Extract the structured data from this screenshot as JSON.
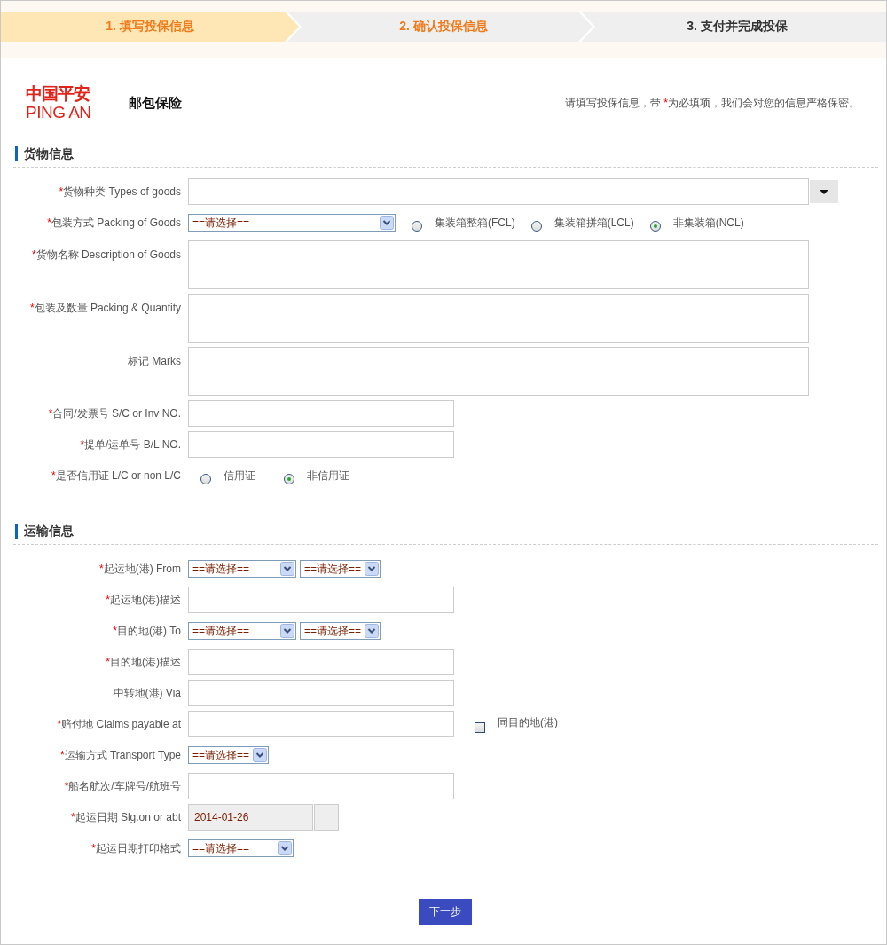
{
  "steps": [
    {
      "label": "1. 填写投保信息",
      "selected": true,
      "accent": true
    },
    {
      "label": "2. 确认投保信息",
      "selected": false,
      "accent": true
    },
    {
      "label": "3. 支付并完成投保",
      "selected": false,
      "accent": false
    }
  ],
  "header": {
    "logo_cn": "中国平安",
    "logo_en": "PING AN",
    "product": "邮包保险",
    "notice_before": "请填写投保信息，带 ",
    "notice_mark": "*",
    "notice_after": "为必填项，我们会对您的信息严格保密。"
  },
  "sections": [
    {
      "title": "货物信息",
      "rows": [
        {
          "kind": "combo",
          "mark": "*",
          "label": "货物种类  Types of goods"
        },
        {
          "kind": "select_radio",
          "mark": "*",
          "label": "包装方式  Packing of Goods",
          "value": "==请选择==",
          "options": [
            {
              "label": "集装箱整箱(FCL)",
              "selected": false
            },
            {
              "label": "集装箱拼箱(LCL)",
              "selected": false
            },
            {
              "label": "非集装箱(NCL)",
              "selected": true
            }
          ]
        },
        {
          "kind": "textarea",
          "mark": "*",
          "label": "货物名称  Description of Goods"
        },
        {
          "kind": "textarea",
          "mark": "*",
          "label": "包装及数量  Packing & Quantity"
        },
        {
          "kind": "textarea",
          "label": "标记  Marks"
        },
        {
          "kind": "text",
          "mark": "*",
          "label": "合同/发票号  S/C or Inv NO."
        },
        {
          "kind": "text",
          "mark": "*",
          "label": "提单/运单号  B/L NO."
        },
        {
          "kind": "radio",
          "mark": "*",
          "label": "是否信用证  L/C or non L/C",
          "options": [
            {
              "label": "信用证",
              "selected": false
            },
            {
              "label": "非信用证",
              "selected": true
            }
          ]
        }
      ]
    },
    {
      "title": "运输信息",
      "rows": [
        {
          "kind": "select_pair",
          "mark": "*",
          "label": "起运地(港) From",
          "values": [
            "==请选择==",
            "==请选择=="
          ]
        },
        {
          "kind": "text",
          "mark": "*",
          "label": "起运地(港)描述"
        },
        {
          "kind": "select_pair",
          "mark": "*",
          "label": "目的地(港) To",
          "values": [
            "==请选择==",
            "==请选择=="
          ]
        },
        {
          "kind": "text",
          "mark": "*",
          "label": "目的地(港)描述"
        },
        {
          "kind": "text",
          "label": "中转地(港) Via"
        },
        {
          "kind": "text_check",
          "mark": "*",
          "label": "赔付地  Claims payable at",
          "checkbox": {
            "label": "同目的地(港)",
            "checked": false
          }
        },
        {
          "kind": "select_short",
          "mark": "*",
          "label": "运输方式  Transport Type",
          "value": "==请选择=="
        },
        {
          "kind": "text",
          "mark": "*",
          "label": "船名航次/车牌号/航班号"
        },
        {
          "kind": "date",
          "mark": "*",
          "label": "起运日期  Slg.on or abt",
          "value": "2014-01-26"
        },
        {
          "kind": "select_medium",
          "mark": "*",
          "label": "起运日期打印格式",
          "value": "==请选择=="
        }
      ]
    }
  ],
  "submit": {
    "label": "下一步"
  }
}
